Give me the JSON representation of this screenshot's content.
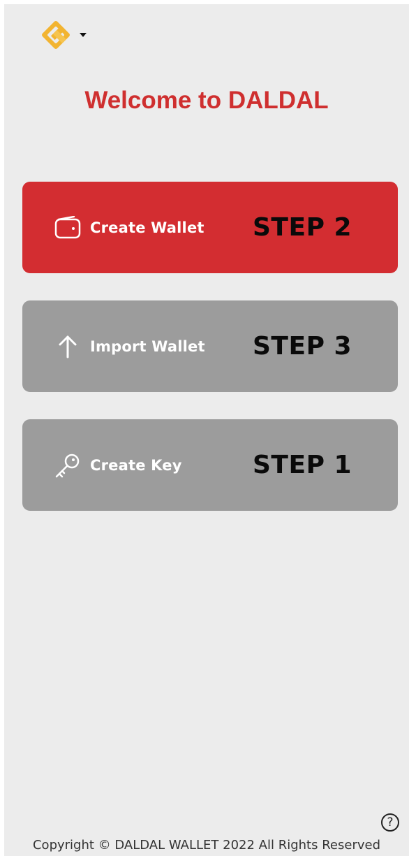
{
  "header": {
    "logo_icon": "daldal-diamond-logo-icon",
    "dropdown_icon": "caret-down-icon"
  },
  "title": "Welcome to DALDAL",
  "actions": [
    {
      "label": "Create Wallet",
      "step": "STEP 2",
      "icon": "wallet-icon",
      "color": "#d32d31"
    },
    {
      "label": "Import Wallet",
      "step": "STEP 3",
      "icon": "arrow-up-icon",
      "color": "#9c9c9c"
    },
    {
      "label": "Create Key",
      "step": "STEP 1",
      "icon": "key-icon",
      "color": "#9c9c9c"
    }
  ],
  "help": {
    "icon": "question-circle-icon",
    "glyph": "?"
  },
  "footer": {
    "copyright": "Copyright © DALDAL WALLET 2022 All Rights Reserved"
  },
  "colors": {
    "brand_red": "#cf2f2f",
    "logo_gold": "#f2b431",
    "background": "#ececec"
  }
}
